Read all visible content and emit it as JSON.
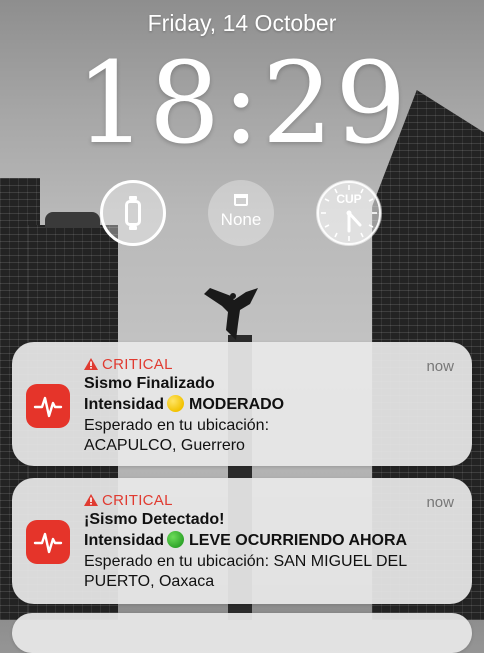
{
  "lockscreen": {
    "date": "Friday, 14 October",
    "time": "18:29"
  },
  "widgets": {
    "watch_icon": "watch-icon",
    "calendar_label": "None",
    "clock_label": "CUP"
  },
  "notifications": [
    {
      "level": "CRITICAL",
      "time": "now",
      "title": "Sismo Finalizado",
      "intensity_label": "Intensidad",
      "intensity_value": "MODERADO",
      "intensity_color": "#f2c200",
      "body_line1": "Esperado en tu ubicación:",
      "body_line2": "ACAPULCO, Guerrero"
    },
    {
      "level": "CRITICAL",
      "time": "now",
      "title": "¡Sismo Detectado!",
      "intensity_label": "Intensidad",
      "intensity_value": "LEVE OCURRIENDO AHORA",
      "intensity_color": "#2fa52a",
      "body_line1": "Esperado en tu ubicación: SAN MIGUEL DEL",
      "body_line2": "PUERTO, Oaxaca"
    }
  ],
  "colors": {
    "critical": "#e03b31",
    "app_icon": "#e5342a"
  }
}
